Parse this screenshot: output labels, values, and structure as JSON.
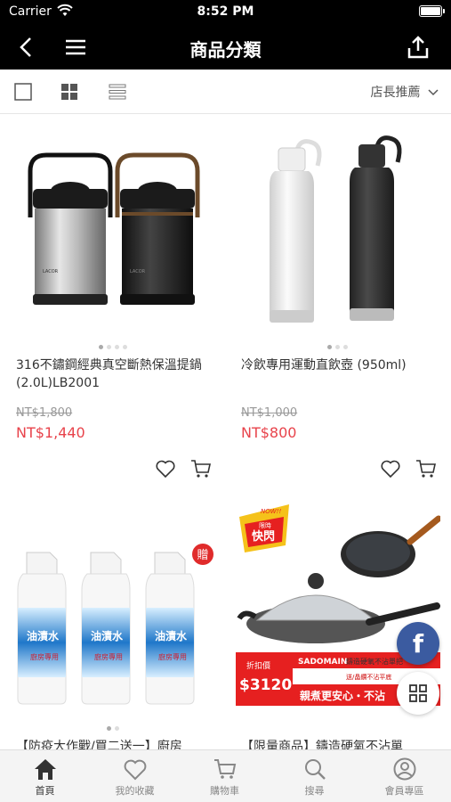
{
  "status_bar": {
    "carrier": "Carrier",
    "time": "8:52 PM"
  },
  "nav": {
    "title": "商品分類"
  },
  "toolbar": {
    "sort_label": "店長推薦"
  },
  "products": [
    {
      "name": "316不鏽鋼經典真空斷熱保溫提鍋 (2.0L)LB2001",
      "original_price": "NT$1,800",
      "price": "NT$1,440",
      "image_dots": 4,
      "active_dot": 0
    },
    {
      "name": "冷飲專用運動直飲壺 (950ml)",
      "original_price": "NT$1,000",
      "price": "NT$800",
      "image_dots": 3,
      "active_dot": 0
    },
    {
      "name": "【防疫大作戰/買二送一】廚房",
      "badge": "贈",
      "product_label": "油漬水",
      "label_sub": "廚房專用",
      "image_dots": 2,
      "active_dot": 0
    },
    {
      "name": "【限量商品】鑄造硬氧不沾單",
      "promo": {
        "tag_top": "NOW!!",
        "tag_mid": "限時",
        "tag_main": "快閃",
        "price_label": "折扣價",
        "price": "$3120",
        "brand": "SADOMAIN",
        "banner_line1": "鑄造硬氧不沾單把",
        "banner_line2": "送/晶鑽不沾平底",
        "slogan": "親煮更安心・不沾"
      }
    }
  ],
  "floating": {
    "facebook": "f"
  },
  "tabs": [
    {
      "label": "首頁",
      "icon": "home-icon",
      "active": true
    },
    {
      "label": "我的收藏",
      "icon": "heart-icon",
      "active": false
    },
    {
      "label": "購物車",
      "icon": "cart-icon",
      "active": false
    },
    {
      "label": "搜尋",
      "icon": "search-icon",
      "active": false
    },
    {
      "label": "會員專區",
      "icon": "user-icon",
      "active": false
    }
  ],
  "colors": {
    "price": "#e8434b",
    "header": "#000000",
    "facebook": "#3b5ba0"
  }
}
